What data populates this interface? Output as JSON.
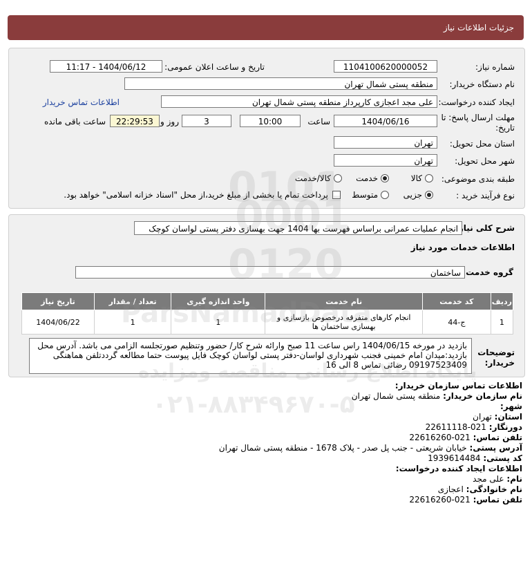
{
  "header": {
    "title": "جزئیات اطلاعات نیاز"
  },
  "form": {
    "need_number_label": "شماره نیاز:",
    "need_number": "1104100620000052",
    "announce_label": "تاریخ و ساعت اعلان عمومی:",
    "announce_value": "1404/06/12 - 11:17",
    "buyer_org_label": "نام دستگاه خریدار:",
    "buyer_org": "منطقه پستی شمال تهران",
    "requester_label": "ایجاد کننده درخواست:",
    "requester": "علی مجد اعجازی کارپرداز منطقه پستی شمال تهران",
    "buyer_contact_link": "اطلاعات تماس خریدار",
    "deadline_label_1": "مهلت ارسال پاسخ: تا",
    "deadline_label_2": "تاریخ:",
    "deadline_date": "1404/06/16",
    "time_label": "ساعت",
    "deadline_time": "10:00",
    "days_value": "3",
    "days_label": "روز و",
    "remaining_time": "22:29:53",
    "remaining_label": "ساعت باقی مانده",
    "province_label": "استان محل تحویل:",
    "province": "تهران",
    "city_label": "شهر محل تحویل:",
    "city": "تهران",
    "category_label": "طبقه بندی موضوعی:",
    "category_options": [
      "کالا",
      "خدمت",
      "کالا/خدمت"
    ],
    "category_selected": "خدمت",
    "process_label": "نوع فرآیند خرید :",
    "process_options": [
      "جزیی",
      "متوسط"
    ],
    "process_selected": "جزیی",
    "treasury_note": "پرداخت تمام یا بخشی از مبلغ خرید،از محل \"اسناد خزانه اسلامی\" خواهد بود."
  },
  "summary": {
    "label": "شرح کلی نیاز:",
    "value": "انجام عملیات عمرانی براساس فهرست بها 1404 جهت بهسازی دفتر پستی لواسان کوچک",
    "services_heading": "اطلاعات خدمات مورد نیاز",
    "service_group_label": "گروه خدمت:",
    "service_group": "ساختمان"
  },
  "table": {
    "headers": [
      "ردیف",
      "کد خدمت",
      "نام خدمت",
      "واحد اندازه گیری",
      "تعداد / مقدار",
      "تاریخ نیاز"
    ],
    "rows": [
      [
        "1",
        "ج-44",
        "انجام کارهای متفرقه درخصوص بازسازی و بهسازی ساختمان ها",
        "1",
        "1",
        "1404/06/22"
      ]
    ]
  },
  "notes": {
    "label_1": "توضیحات",
    "label_2": "خریدار:",
    "text": "بازدید در مورخه 1404/06/15 راس ساعت 11 صبح وارائه شرح کار/ حضور وتنظیم صورتجلسه الزامی می باشد. آدرس محل بازدید:میدان امام خمینی فجنب شهرداری لواسان-دفتر پستی لواسان کوچک فایل پیوست حتما مطالعه گرددتلفن هماهنگی 09197523409 رضائی تماس 8 الی 16"
  },
  "contact": {
    "heading": "اطلاعات تماس سازمان خریدار:",
    "org_label": "نام سازمان خریدار:",
    "org": "منطقه پستی شمال تهران",
    "city_label": "شهر:",
    "city": "",
    "province_label": "استان:",
    "province": "تهران",
    "fax_label": "دورنگار:",
    "fax": "021-22611118",
    "phone_label": "تلفن تماس:",
    "phone": "021-22616260",
    "address_label": "آدرس پستی:",
    "address": "خیابان شریعتی - جنب پل صدر - پلاک 1678 - منطقه پستی شمال تهران",
    "postal_label": "کد پستی:",
    "postal": "1939614484",
    "creator_heading": "اطلاعات ایجاد کننده درخواست:",
    "name_label": "نام:",
    "name": "علی مجد",
    "family_label": "نام خانوادگی:",
    "family": "اعجازی",
    "creator_phone_label": "تلفن تماس:",
    "creator_phone": "021-22616260"
  },
  "watermark": {
    "brand": "ParsNamadData",
    "tagline": "پایگاه اطلاع رسانی مناقصه ومزایده",
    "phone": "۰۲۱-۸۸۳۴۹۶۷۰-۵",
    "digits_1": "0101",
    "digits_2": "0001",
    "digits_3": "0120"
  },
  "colors": {
    "header_bg": "#8a3c3c",
    "panel_bg": "#f0f0f0",
    "table_header_bg": "#7b7b7b",
    "link": "#1a3f9e",
    "remaining_bg": "#fbf7d3"
  }
}
